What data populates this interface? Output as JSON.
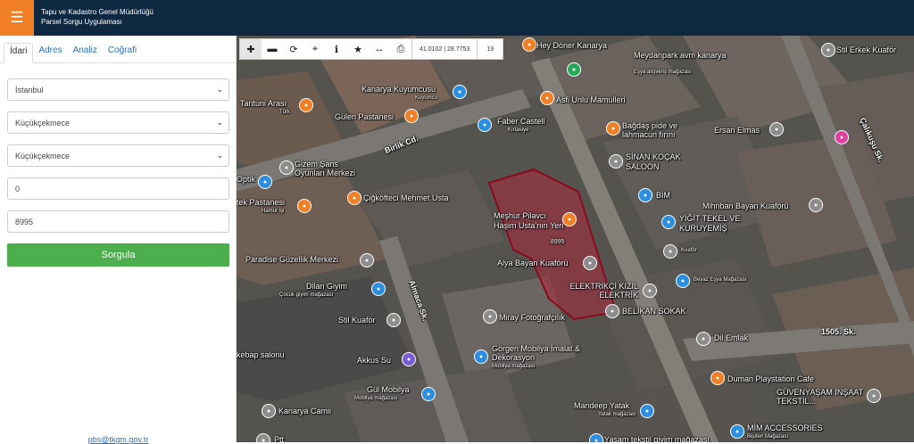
{
  "header": {
    "menu_icon": "hamburger-icon",
    "title_line1": "Tapu ve Kadastro Genel Müdürlüğü",
    "title_line2": "Parsel Sorgu Uygulaması",
    "colors": {
      "bar": "#0d2840",
      "menu": "#f07f26"
    }
  },
  "sidebar": {
    "tabs": [
      {
        "label": "İdari",
        "active": true
      },
      {
        "label": "Adres"
      },
      {
        "label": "Analiz"
      },
      {
        "label": "Coğrafi"
      }
    ],
    "il": "İstanbul",
    "ilce": "Küçükçekmece",
    "mahalle": "Küçükçekmece",
    "ada": "0",
    "parsel": "8995",
    "submit_label": "Sorgula",
    "submit_color": "#4cae4c",
    "footer_link": "pbs@tkgm.gov.tr"
  },
  "toolbar": {
    "buttons": [
      "zoom-in-icon",
      "zoom-out-icon",
      "refresh-icon",
      "locate-icon",
      "info-icon",
      "star-icon",
      "measure-icon",
      "print-icon"
    ],
    "coords": "41.0102 | 28.7753",
    "zoom": "19"
  },
  "map": {
    "parcel_label": "8995",
    "places": [
      {
        "key": "hey_doner",
        "name": "Hey Döner Kanarya"
      },
      {
        "key": "stil_erkek",
        "name": "Stil Erkek Kuaför"
      },
      {
        "key": "meydanpark",
        "name": "Meydanpark avm kanarya",
        "sub": "Eşya alışveriş mağazası"
      },
      {
        "key": "kanarya_kuyum",
        "name": "Kanarya Kuyumcusu",
        "sub": "Kuyumcu"
      },
      {
        "key": "asfi",
        "name": "Asfi Unlu Mamulleri"
      },
      {
        "key": "tantuni",
        "name": "Tantuni Arası",
        "sub": "Türk"
      },
      {
        "key": "gulen",
        "name": "Gülen Pastanesi"
      },
      {
        "key": "faber",
        "name": "Faber Castell",
        "sub": "Kırtasiye"
      },
      {
        "key": "bagdas",
        "name": "Bağdaş pide ve lahmacun fırını"
      },
      {
        "key": "ersan",
        "name": "Ersan Elmas"
      },
      {
        "key": "sinan",
        "name": "SİNAN KOÇAK SALOON"
      },
      {
        "key": "gizem",
        "name": "Gizem Şans Oyunları Merkezi"
      },
      {
        "key": "optik",
        "name": "Optik"
      },
      {
        "key": "cigkofteci",
        "name": "Çiğköfteci Mehmet Usta"
      },
      {
        "key": "bim",
        "name": "BİM"
      },
      {
        "key": "tek_pastanesi",
        "name": "tek Pastanesi",
        "sub": "Hamur işi"
      },
      {
        "key": "mihriban",
        "name": "Mihriban Bayan Kuaförü"
      },
      {
        "key": "mesur",
        "name": "Meşhur Pilavcı Haşim Usta'nın Yeri"
      },
      {
        "key": "yigit",
        "name": "YİĞİT TEKEL VE KURUYEMİŞ"
      },
      {
        "key": "kuafor",
        "name": "Kuaför"
      },
      {
        "key": "paradise",
        "name": "Paradise Güzellik Merkezi"
      },
      {
        "key": "alya",
        "name": "Alya Bayan Kuaförü"
      },
      {
        "key": "beyaz",
        "name": "Beyaz Eşya Mağazası"
      },
      {
        "key": "dilan",
        "name": "Dilan Giyim",
        "sub": "Çocuk giyim mağazası"
      },
      {
        "key": "elektrikci",
        "name": "ELEKTRİKÇİ KIZIL ELEKTRİK"
      },
      {
        "key": "belikan",
        "name": "BELİKAN SOKAK"
      },
      {
        "key": "stil_kuafor",
        "name": "Stil Kuaför"
      },
      {
        "key": "miray",
        "name": "Miray Fotoğrafçılık"
      },
      {
        "key": "dil_emlak",
        "name": "Dil Emlak"
      },
      {
        "key": "kebap",
        "name": "kebap salonu"
      },
      {
        "key": "gorgen",
        "name": "Görgen Mobilya İmalat & Dekorasyon",
        "sub": "Mobilya mağazası"
      },
      {
        "key": "akkus",
        "name": "Akkus Su"
      },
      {
        "key": "duman",
        "name": "Duman Playstation Cafe"
      },
      {
        "key": "gul",
        "name": "Gül Mobilya",
        "sub": "Mobilya mağazası"
      },
      {
        "key": "guvenyasam",
        "name": "GÜVENYAŞAM İNŞAAT TEKSTİL..."
      },
      {
        "key": "kanarya_cami",
        "name": "Kanarya Camii"
      },
      {
        "key": "mandeep",
        "name": "Mandeep Yatak",
        "sub": "Yatak mağazası"
      },
      {
        "key": "mim",
        "name": "MİM ACCESSORIES",
        "sub": "Bijuteri Mağazası"
      },
      {
        "key": "yasam",
        "name": "Yaşam tekstil giyim mağazası"
      },
      {
        "key": "ptt",
        "name": "Ptt"
      }
    ],
    "roads": [
      {
        "key": "birlik",
        "name": "Birlik Cd."
      },
      {
        "key": "almaca",
        "name": "Almaca Sk."
      },
      {
        "key": "calikusu",
        "name": "Çalıkuşu Sk."
      },
      {
        "key": "s1505",
        "name": "1505. Sk."
      }
    ],
    "pin_colors": {
      "food": "#f07f26",
      "shop": "#2b8ede",
      "service": "#8d8d8d",
      "green": "#2aa85a",
      "pink": "#e040a0"
    }
  }
}
